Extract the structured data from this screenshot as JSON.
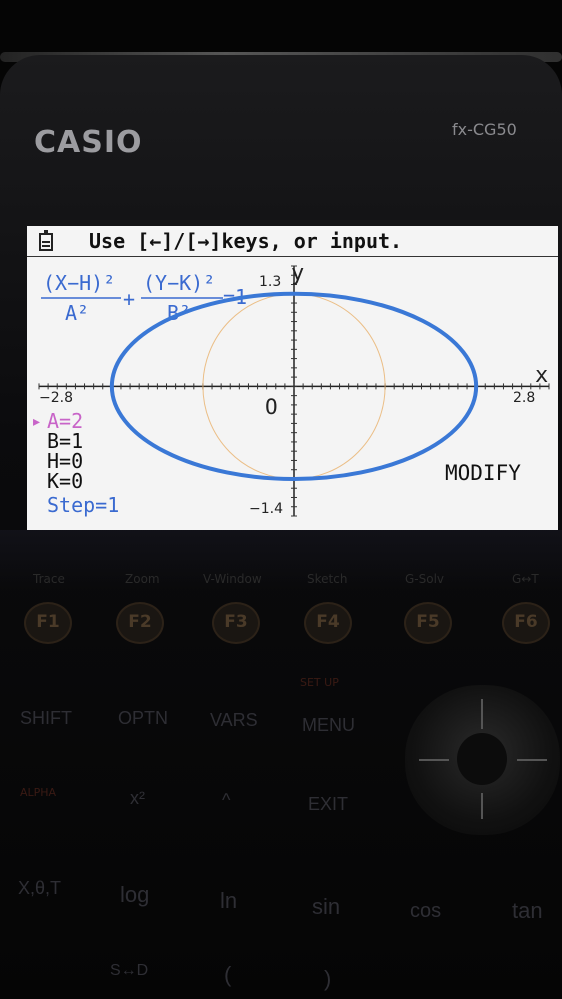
{
  "device": {
    "brand": "CASIO",
    "model": "fx-CG50"
  },
  "status_bar": {
    "text": "Use [←]/[→]keys, or input."
  },
  "equation": {
    "numerator1": "(X−H)²",
    "denominator1": "A²",
    "plus": "+",
    "numerator2": "(Y−K)²",
    "denominator2": "B²",
    "equals": "=1"
  },
  "graph": {
    "type": "ellipse",
    "x_axis_label": "x",
    "y_axis_label": "y",
    "x_min_label": "−2.8",
    "x_max_label": "2.8",
    "y_max_label": "1.3",
    "y_min_label": "−1.4",
    "origin_label": "O",
    "xlim": [
      -2.8,
      2.8
    ],
    "ylim": [
      -1.4,
      1.3
    ],
    "ellipse": {
      "h": 0,
      "k": 0,
      "a": 2,
      "b": 1
    },
    "colors": {
      "axis": "#222222",
      "curve": "#3a78d6",
      "trace": "#e8b06a",
      "param_selected": "#c864c8",
      "step": "#3a6ad0"
    }
  },
  "parameters": {
    "selected_marker": "▸",
    "items": [
      {
        "label": "A=2",
        "selected": true
      },
      {
        "label": "B=1",
        "selected": false
      },
      {
        "label": "H=0",
        "selected": false
      },
      {
        "label": "K=0",
        "selected": false
      }
    ],
    "step": "Step=1"
  },
  "modify_label": "MODIFY",
  "fkeys": {
    "labels": [
      "Trace",
      "Zoom",
      "V-Window",
      "Sketch",
      "G-Solv",
      "G↔T"
    ],
    "keys": [
      "F1",
      "F2",
      "F3",
      "F4",
      "F5",
      "F6"
    ]
  },
  "keyboard": {
    "row1": [
      "SHIFT",
      "OPTN",
      "VARS",
      "MENU"
    ],
    "row1_sub": [
      "",
      "",
      "",
      "SET UP"
    ],
    "row2": [
      "x²",
      "^",
      "EXIT"
    ],
    "row2_sub": [
      "ALPHA"
    ],
    "row3": [
      "X,θ,T",
      "log",
      "ln",
      "sin",
      "cos",
      "tan"
    ],
    "row4": [
      "S↔D",
      "(",
      ")"
    ]
  }
}
